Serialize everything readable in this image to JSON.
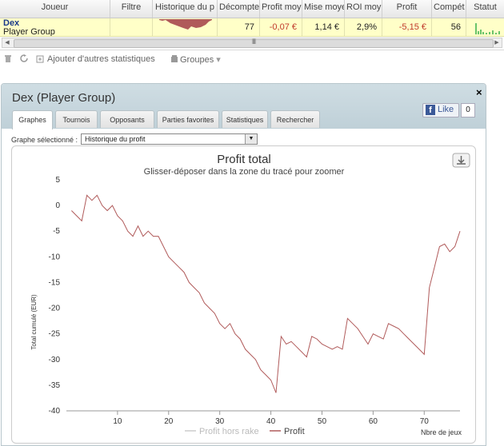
{
  "grid": {
    "columns": [
      "Joueur",
      "Filtre",
      "Historique du p",
      "Décompte",
      "Profit moy",
      "Mise moye",
      "ROI moy",
      "Profit",
      "Compét",
      "Statut"
    ],
    "row": {
      "player_name": "Dex",
      "player_group": "Player Group",
      "count": "77",
      "profit_avg": "-0,07 €",
      "stake_avg": "1,14 €",
      "roi_avg": "2,9%",
      "profit": "-5,15 €",
      "compet": "56"
    },
    "scroll_grip": "III"
  },
  "toolbar": {
    "add_stats": "Ajouter d'autres statistiques",
    "groups": "Groupes"
  },
  "panel": {
    "title": "Dex (Player Group)",
    "close": "×",
    "like_label": "Like",
    "like_count": "0",
    "tabs": [
      "Graphes",
      "Tournois",
      "Opposants",
      "Parties favorites",
      "Statistiques",
      "Rechercher"
    ],
    "selector_label": "Graphe sélectionné :",
    "selector_value": "Historique du profit"
  },
  "colors": {
    "series": "#b05a5a",
    "muted_series": "#cccccc",
    "row_bg": "#ffffc8"
  },
  "chart_data": {
    "type": "line",
    "title": "Profit total",
    "subtitle": "Glisser-déposer dans la zone du tracé pour zoomer",
    "ylabel": "Total cumulé (EUR)",
    "xlabel": "Nbre de jeux",
    "xlim": [
      0,
      77
    ],
    "ylim": [
      -40,
      5
    ],
    "xticks": [
      10,
      20,
      30,
      40,
      50,
      60,
      70
    ],
    "yticks": [
      5,
      0,
      -5,
      -10,
      -15,
      -20,
      -25,
      -30,
      -35,
      -40
    ],
    "legend": [
      "Profit hors rake",
      "Profit"
    ],
    "legend_position": "bottom",
    "series": [
      {
        "name": "Profit",
        "x": [
          1,
          2,
          3,
          4,
          5,
          6,
          7,
          8,
          9,
          10,
          11,
          12,
          13,
          14,
          15,
          16,
          17,
          18,
          19,
          20,
          21,
          22,
          23,
          24,
          25,
          26,
          27,
          28,
          29,
          30,
          31,
          32,
          33,
          34,
          35,
          36,
          37,
          38,
          39,
          40,
          41,
          42,
          43,
          44,
          45,
          46,
          47,
          48,
          49,
          50,
          51,
          52,
          53,
          54,
          55,
          56,
          57,
          58,
          59,
          60,
          61,
          62,
          63,
          64,
          65,
          66,
          67,
          68,
          69,
          70,
          71,
          72,
          73,
          74,
          75,
          76,
          77
        ],
        "y": [
          -1,
          -2,
          -3,
          2,
          1,
          2,
          0,
          -1,
          0,
          -2,
          -3,
          -5,
          -6,
          -4,
          -6,
          -5,
          -6,
          -6,
          -8,
          -10,
          -11,
          -12,
          -13,
          -15,
          -16,
          -17,
          -19,
          -20,
          -21,
          -23,
          -24,
          -23,
          -25,
          -26,
          -28,
          -29,
          -30,
          -32,
          -33,
          -34,
          -36.5,
          -25.5,
          -27,
          -26.5,
          -27.5,
          -28.5,
          -29.5,
          -25.5,
          -26,
          -27,
          -27.5,
          -28,
          -27.5,
          -28,
          -22,
          -23,
          -24,
          -25.5,
          -27,
          -25,
          -25.5,
          -26,
          -23,
          -23.5,
          -24,
          -25,
          -26,
          -27,
          -28,
          -29,
          -16,
          -12,
          -8,
          -7.5,
          -9,
          -8,
          -5
        ]
      }
    ]
  }
}
